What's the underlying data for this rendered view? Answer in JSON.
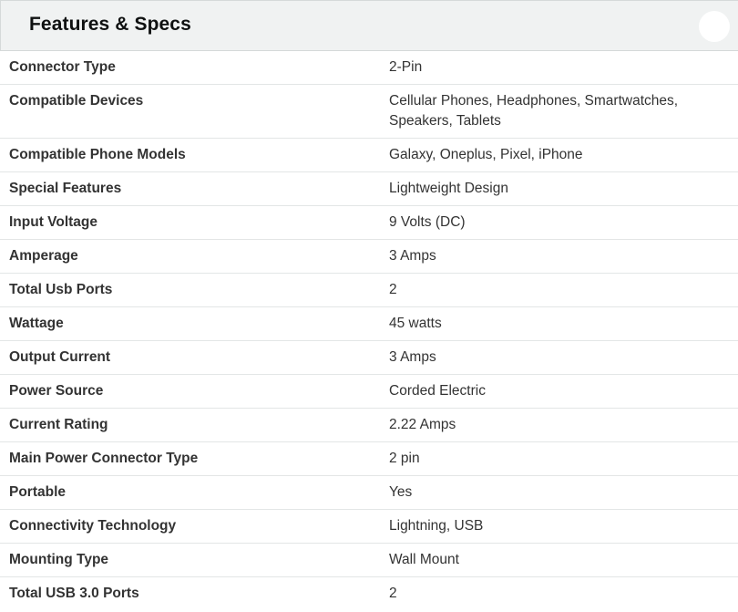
{
  "header": {
    "title": "Features & Specs"
  },
  "specs": [
    {
      "label": "Connector Type",
      "value": "2-Pin"
    },
    {
      "label": "Compatible Devices",
      "value": "Cellular Phones, Headphones, Smartwatches, Speakers, Tablets"
    },
    {
      "label": "Compatible Phone Models",
      "value": "Galaxy, Oneplus, Pixel, iPhone"
    },
    {
      "label": "Special Features",
      "value": "Lightweight Design"
    },
    {
      "label": "Input Voltage",
      "value": "9 Volts (DC)"
    },
    {
      "label": "Amperage",
      "value": "3 Amps"
    },
    {
      "label": "Total Usb Ports",
      "value": "2"
    },
    {
      "label": "Wattage",
      "value": "45 watts"
    },
    {
      "label": "Output Current",
      "value": "3 Amps"
    },
    {
      "label": "Power Source",
      "value": "Corded Electric"
    },
    {
      "label": "Current Rating",
      "value": "2.22 Amps"
    },
    {
      "label": "Main Power Connector Type",
      "value": "2 pin"
    },
    {
      "label": "Portable",
      "value": "Yes"
    },
    {
      "label": "Connectivity Technology",
      "value": "Lightning, USB"
    },
    {
      "label": "Mounting Type",
      "value": "Wall Mount"
    },
    {
      "label": "Total USB 3.0 Ports",
      "value": "2"
    }
  ]
}
